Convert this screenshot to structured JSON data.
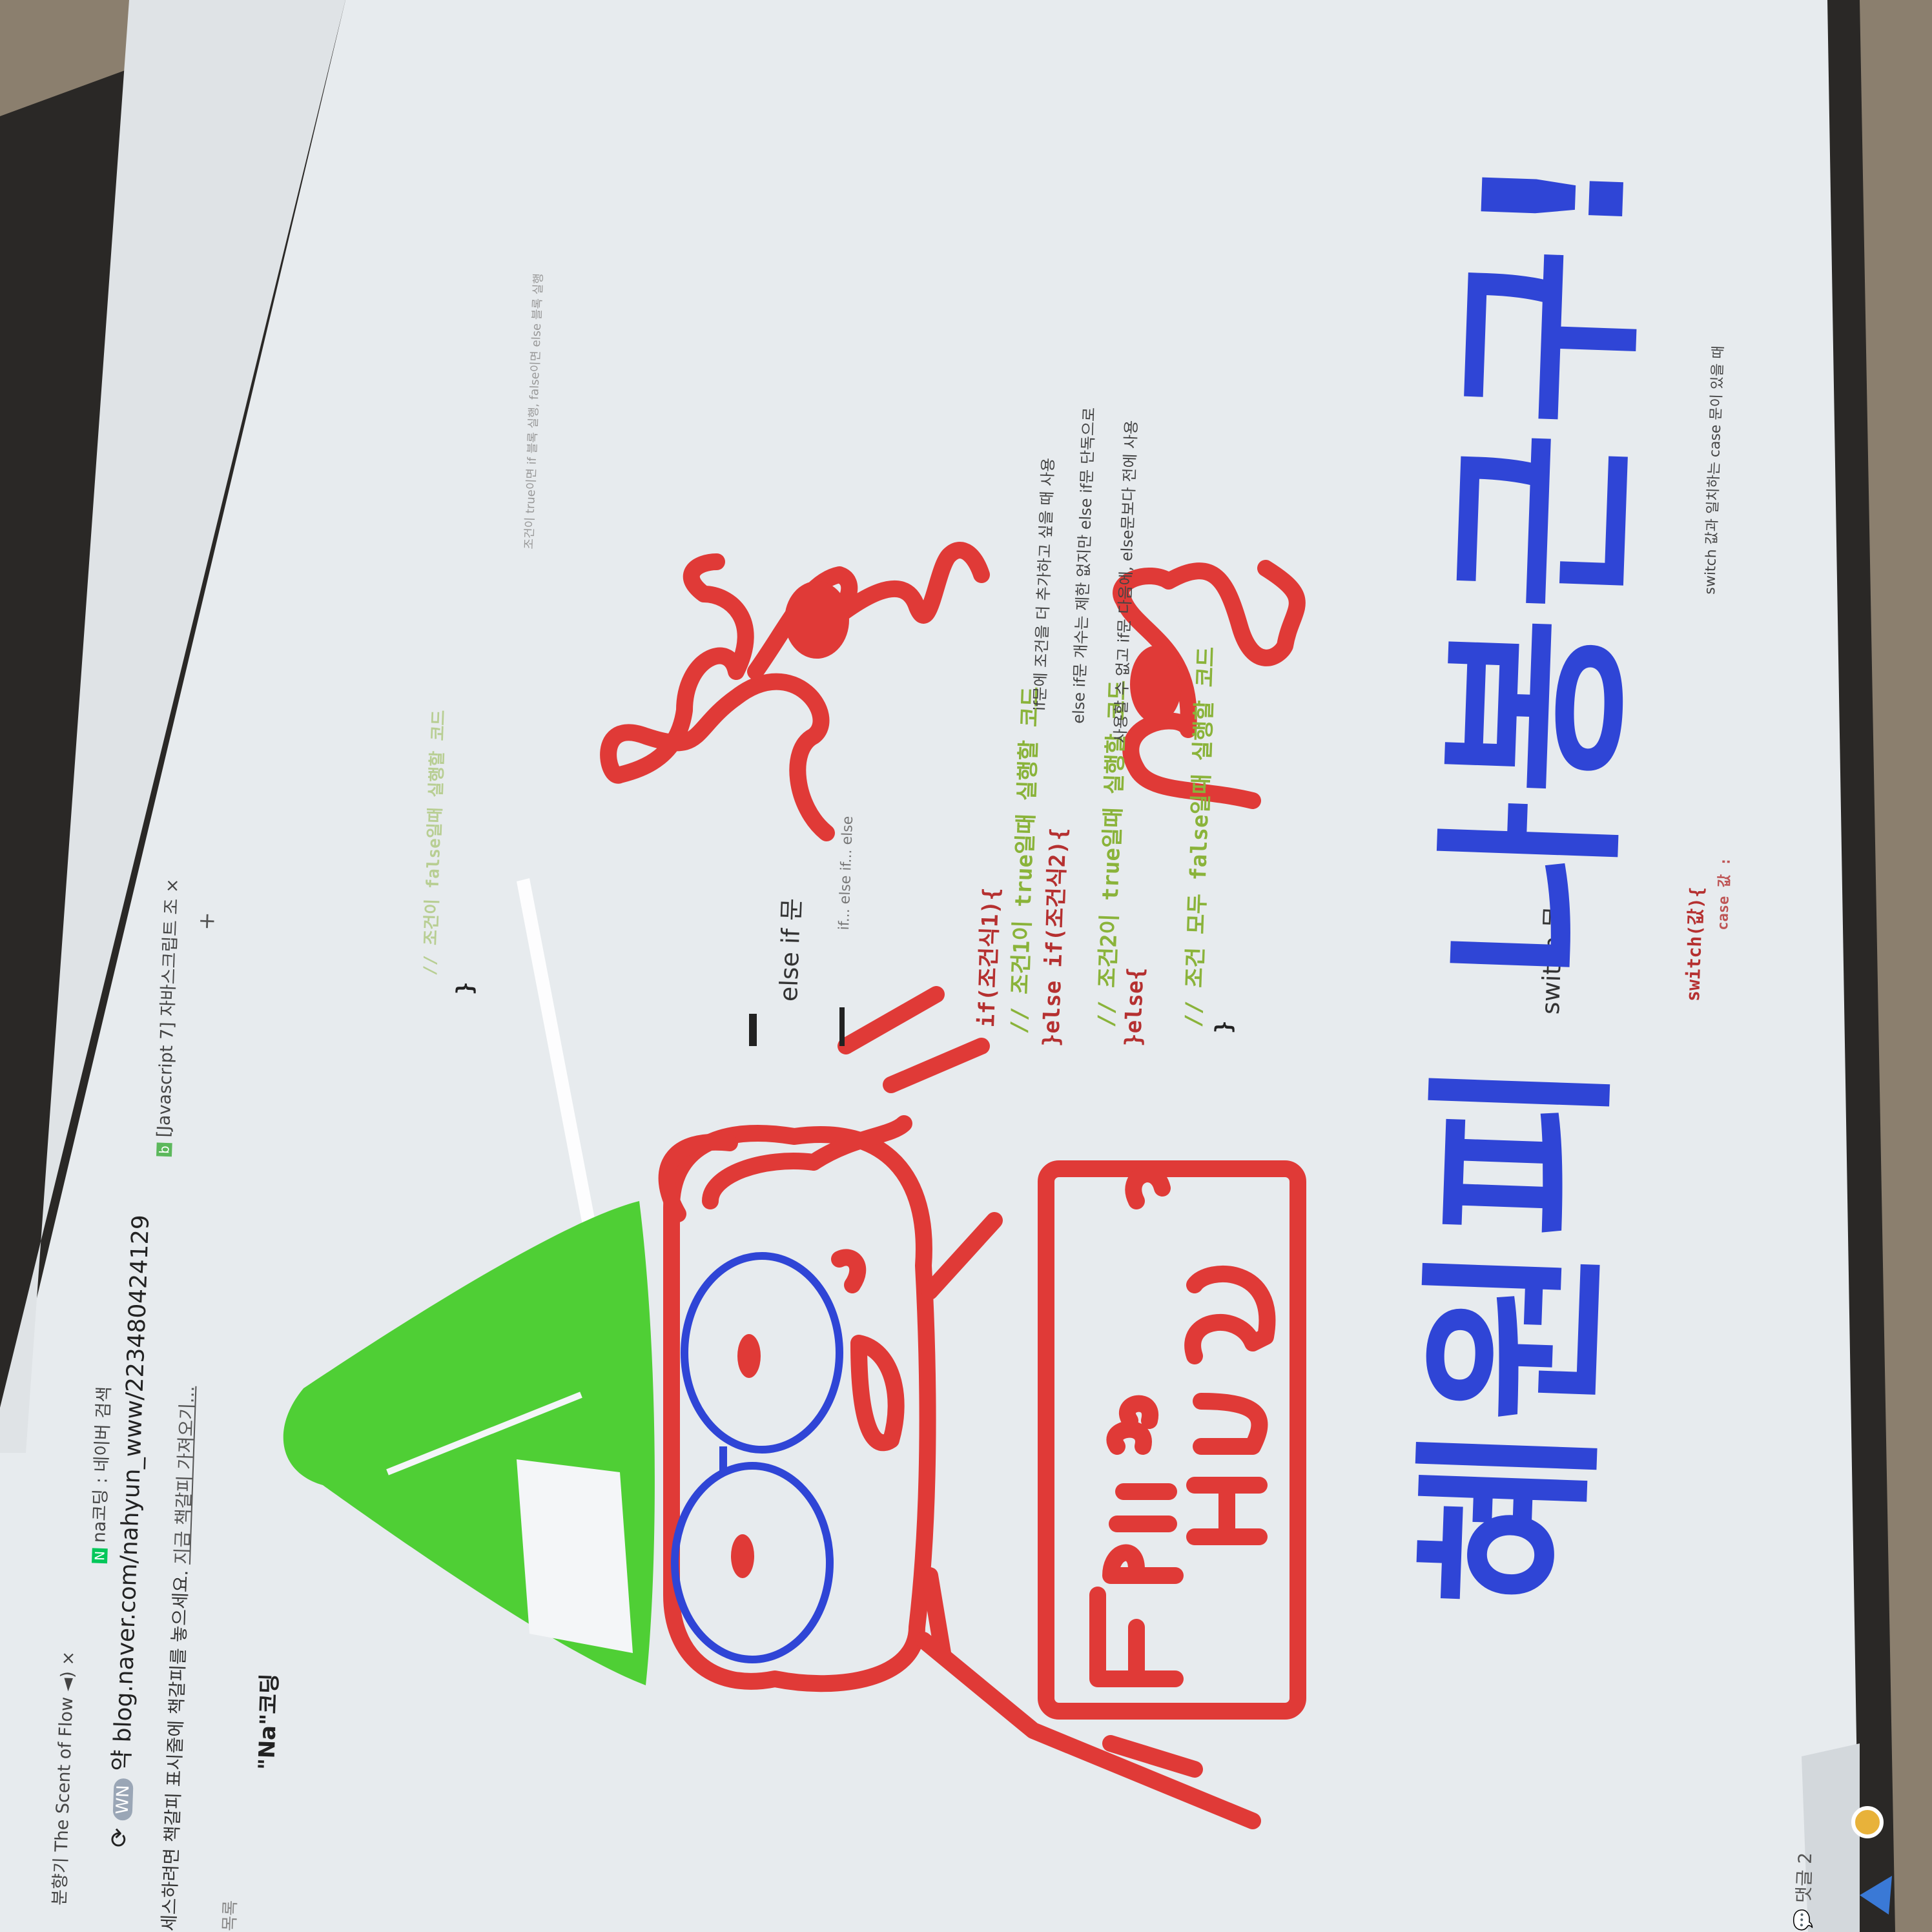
{
  "browser": {
    "tabs": [
      {
        "label": "분향기 The Scent of Flow",
        "sound_icon": "speaker-icon"
      },
      {
        "label": "na코딩 : 네이버 검색",
        "favicon": "naver-icon"
      },
      {
        "label": "[Javascript 7] 자바스크립트 조",
        "favicon": "blog-icon"
      }
    ],
    "new_tab": "+",
    "close": "×",
    "url": "blog.naver.com/nahyun_www/223480424129",
    "url_prefix": "약",
    "profile": "WN",
    "bookmark_hint": "빠른 접근을 위해 즐겨찾기 표시줄에 책갈피를 놓으세요.",
    "bookmark_hint_partial": "세스하려면 책갈피 표시줄에 책갈피를 놓으세요.",
    "bookmark_link": "지금 책갈피 가져오기...",
    "sidebar_label": "목록"
  },
  "blog": {
    "title": "\"Na\"코딩",
    "comments": "댓글 2"
  },
  "content": {
    "faint_line": "// 조건이 false일때 실행할 코드",
    "top_brace": "}",
    "faint_note": "조건이 true이면 if 블록 실행, false이면 else 블록 실행",
    "section_elseif": "else if 문",
    "elseif_desc": "if... else if... else",
    "code_lines": [
      {
        "text": "if(조건식1){",
        "color": "#b53030"
      },
      {
        "text": "// 조건1이 true일때 실행할 코드",
        "color": "#8ab33a"
      },
      {
        "text": "}else if(조건식2){",
        "color": "#b53030"
      },
      {
        "text": "// 조건2이 true일때 실행할 코드",
        "color": "#8ab33a"
      },
      {
        "text": "}else{",
        "color": "#b53030"
      },
      {
        "text": "// 조건 모두 false일때 실행할 코드",
        "color": "#8ab33a"
      },
      {
        "text": "}",
        "color": "#222222"
      }
    ],
    "explanations": [
      "if문에 조건을 더 추가하고 싶을 때 사용",
      "else if문 개수는 제한 없지만 else if문 단독으로",
      "사용할 수 없고 if문 다음에, else문보다 전에 사용"
    ],
    "section_switch": "switch 문",
    "switch_code": "switch(값){",
    "switch_case": "case 값 :",
    "switch_desc": "switch 값과 일치하는 case 문이 있을 때"
  },
  "drawing": {
    "headline": "혜원피 나봉근구!",
    "sign_line1": "Free",
    "sign_line2": "Hug",
    "colors": {
      "red": "#e03a37",
      "blue": "#2f45d6",
      "green": "#4fcf35",
      "white": "#f4f6f8",
      "screen": "#e7ebee"
    }
  }
}
